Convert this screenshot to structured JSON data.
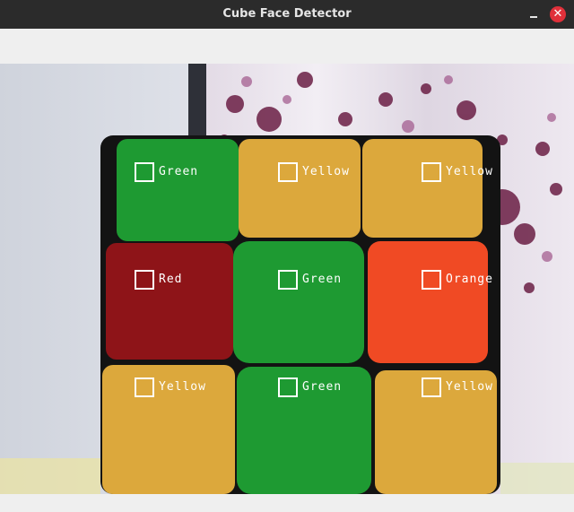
{
  "window": {
    "title": "Cube Face Detector",
    "minimize_glyph": "–",
    "close_glyph": "✕"
  },
  "colors": {
    "Green": "#1e9a32",
    "Yellow": "#dca83c",
    "Red": "#8e1418",
    "Orange": "#f04a24",
    "titlebar": "#2b2b2b",
    "close": "#e0303a"
  },
  "detections": [
    {
      "label": "Green"
    },
    {
      "label": "Yellow"
    },
    {
      "label": "Yellow"
    },
    {
      "label": "Red"
    },
    {
      "label": "Green"
    },
    {
      "label": "Orange"
    },
    {
      "label": "Yellow"
    },
    {
      "label": "Green"
    },
    {
      "label": "Yellow"
    }
  ]
}
